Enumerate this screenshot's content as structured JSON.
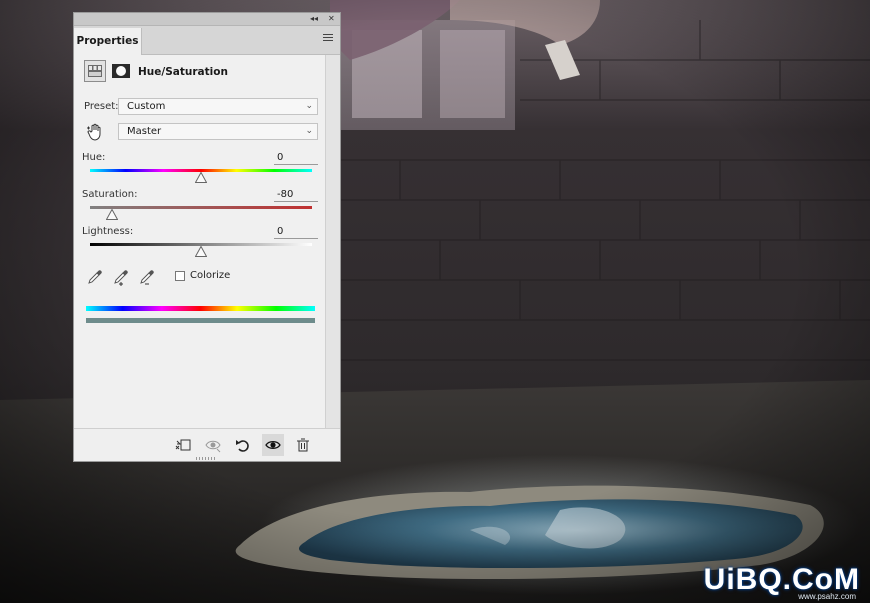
{
  "panel": {
    "tab_label": "Properties",
    "adjustment_title": "Hue/Saturation",
    "preset": {
      "label": "Preset:",
      "value": "Custom"
    },
    "channel": {
      "value": "Master"
    },
    "hue": {
      "label": "Hue:",
      "value": "0",
      "min": -180,
      "max": 180,
      "position": 0
    },
    "saturation": {
      "label": "Saturation:",
      "value": "-80",
      "min": -100,
      "max": 100,
      "position": -80
    },
    "lightness": {
      "label": "Lightness:",
      "value": "0",
      "min": -100,
      "max": 100,
      "position": 0
    },
    "colorize": {
      "label": "Colorize",
      "checked": false
    },
    "icons": {
      "collapse": "double-chevron-left-icon",
      "close": "close-icon",
      "menu": "hamburger-menu-icon",
      "adjustment_layer": "hue-saturation-layer-icon",
      "mask": "layer-mask-icon",
      "targeted_adjust": "hand-scrubby-icon",
      "eyedroppers": [
        "eyedropper-icon",
        "eyedropper-plus-icon",
        "eyedropper-minus-icon"
      ],
      "footer": [
        "clip-to-layer-icon",
        "view-previous-state-icon",
        "reset-icon",
        "visibility-eye-icon",
        "trash-icon"
      ]
    },
    "colors": {
      "panel_bg": "#f0f0f0",
      "tab_bar": "#d6d6d6",
      "saturation_track": "#c03030",
      "output_bar": "#6e8c8c"
    }
  },
  "watermark": {
    "text": "UiBQ.CoM",
    "subtext": "www.psahz.com"
  }
}
